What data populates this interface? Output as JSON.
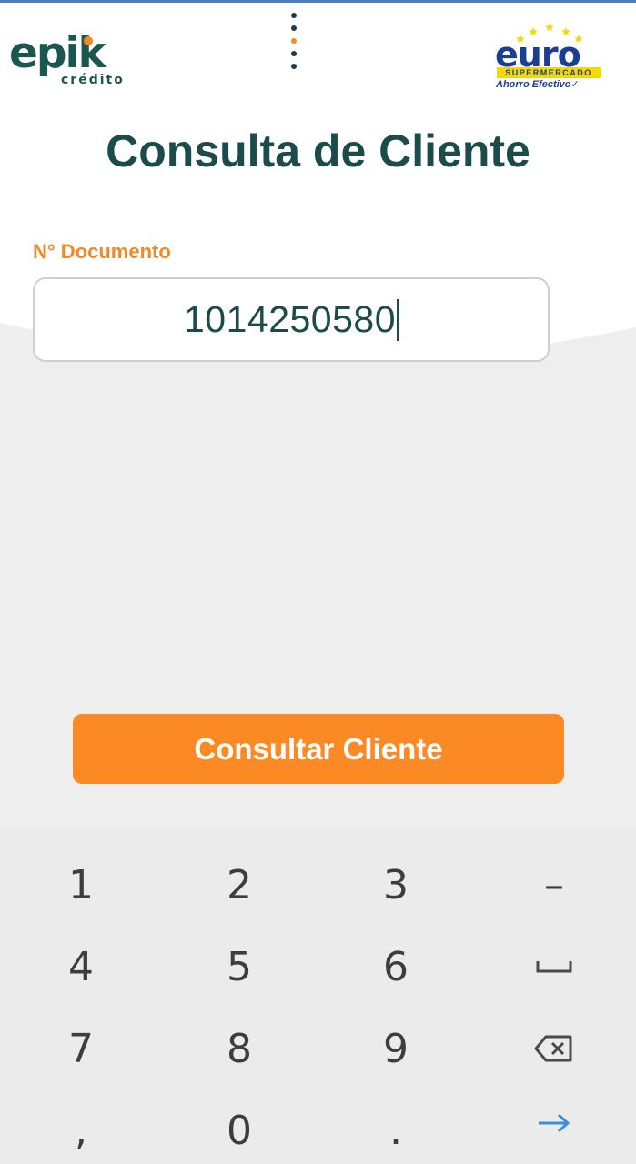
{
  "header": {
    "left_logo": {
      "name": "epik",
      "subtitle": "crédito",
      "icon": "epik-credito-logo"
    },
    "menu_icon": "vertical-dots-menu-icon",
    "right_logo": {
      "name": "euro",
      "band": "SUPERMERCADO",
      "tagline": "Ahorro Efectivo",
      "icon": "euro-supermercado-logo"
    }
  },
  "main": {
    "title": "Consulta de Cliente",
    "document_label": "N° Documento",
    "document_value": "1014250580",
    "submit_label": "Consultar Cliente"
  },
  "keyboard": {
    "rows": [
      [
        "1",
        "2",
        "3",
        "–"
      ],
      [
        "4",
        "5",
        "6",
        "space-icon"
      ],
      [
        "7",
        "8",
        "9",
        "backspace-icon"
      ],
      [
        ",",
        "0",
        ".",
        "enter-arrow-icon"
      ]
    ]
  },
  "colors": {
    "brand_teal": "#1b4b4b",
    "accent_orange": "#fb8a24",
    "label_orange": "#f0892a",
    "euro_blue": "#1c3f94",
    "euro_yellow": "#f5d800",
    "enter_blue": "#3d8fd8"
  }
}
